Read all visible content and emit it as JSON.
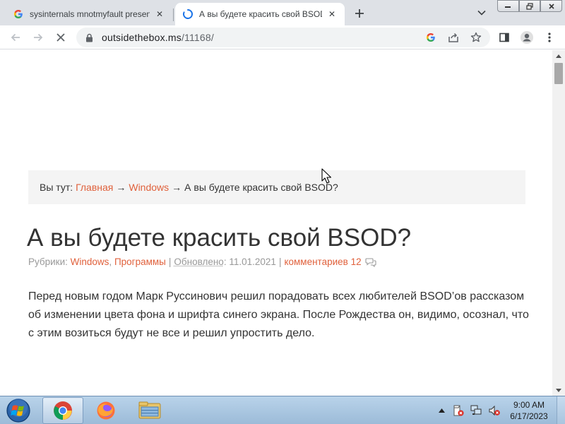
{
  "browser": {
    "tabs": [
      {
        "title": "sysinternals mnotmyfault present",
        "favicon": "google-g-icon",
        "active": false
      },
      {
        "title": "А вы будете красить свой BSOD",
        "favicon": "loading-spinner-icon",
        "active": true
      }
    ],
    "address": {
      "host": "outsidethebox.ms",
      "path": "/11168/"
    }
  },
  "page": {
    "breadcrumb": {
      "prefix": "Вы тут:",
      "home": "Главная",
      "arrow": "→",
      "category": "Windows",
      "current": "А вы будете красить свой BSOD?"
    },
    "title": "А вы будете красить свой BSOD?",
    "meta": {
      "rubrics_label": "Рубрики:",
      "rubric_1": "Windows",
      "comma": ",",
      "rubric_2": "Программы",
      "separator": "|",
      "updated_label": "Обновлено",
      "updated_colon": ":",
      "updated_date": "11.01.2021",
      "comments": "комментариев 12"
    },
    "body": "Перед новым годом Марк Руссинович решил порадовать всех любителей BSOD’ов рассказом об изменении цвета фона и шрифта синего экрана. После Рождества он, видимо, осознал, что с этим возиться будут не все и решил упростить дело."
  },
  "taskbar": {
    "apps": [
      "chrome-icon",
      "firefox-icon",
      "file-explorer-icon"
    ],
    "clock_time": "9:00 AM",
    "clock_date": "6/17/2023"
  },
  "colors": {
    "link": "#e0613c",
    "text": "#333333",
    "meta": "#999999"
  }
}
